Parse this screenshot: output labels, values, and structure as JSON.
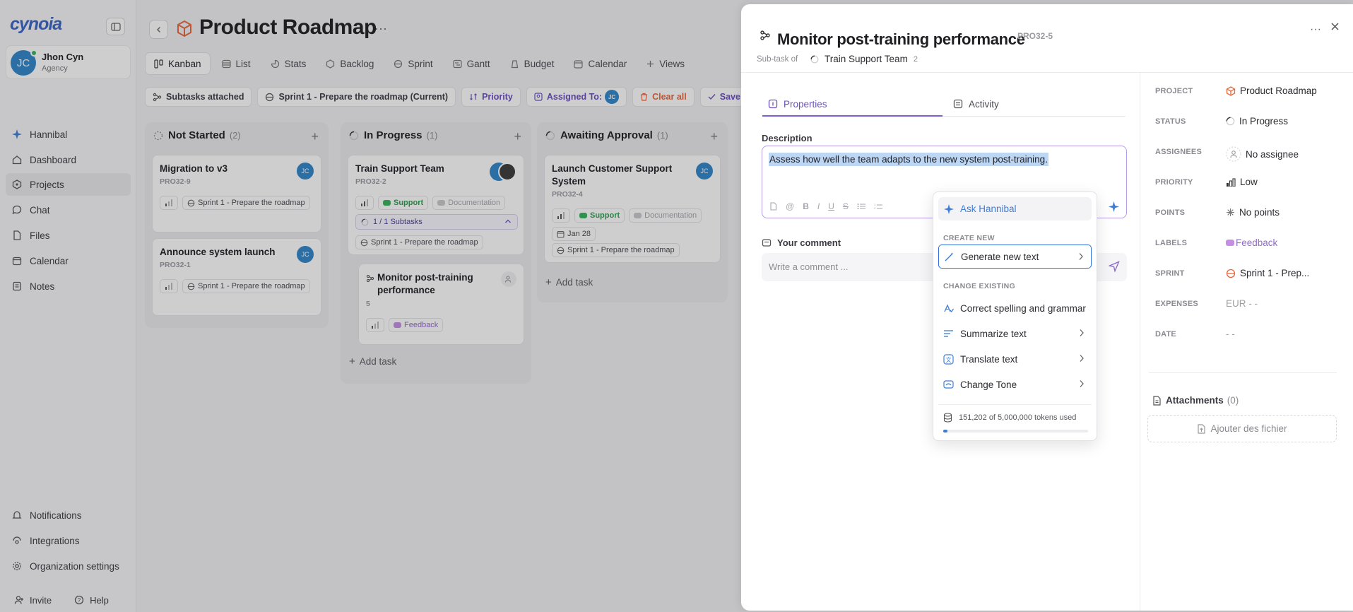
{
  "sidebar": {
    "logo": "cynoia",
    "user": {
      "initials": "JC",
      "name": "Jhon Cyn",
      "role": "Agency"
    },
    "nav": [
      {
        "label": "Hannibal",
        "icon": "sparkle-icon"
      },
      {
        "label": "Dashboard",
        "icon": "home-icon"
      },
      {
        "label": "Projects",
        "icon": "projects-icon",
        "active": true
      },
      {
        "label": "Chat",
        "icon": "chat-icon"
      },
      {
        "label": "Files",
        "icon": "file-icon"
      },
      {
        "label": "Calendar",
        "icon": "calendar-icon"
      },
      {
        "label": "Notes",
        "icon": "notes-icon"
      }
    ],
    "bottom_nav": [
      {
        "label": "Notifications",
        "icon": "bell-icon"
      },
      {
        "label": "Integrations",
        "icon": "integrations-icon"
      },
      {
        "label": "Organization settings",
        "icon": "gear-icon"
      }
    ],
    "invite_label": "Invite",
    "help_label": "Help"
  },
  "header": {
    "title": "Product Roadmap",
    "more": "···",
    "tabs": [
      {
        "label": "Kanban",
        "active": true
      },
      {
        "label": "List"
      },
      {
        "label": "Stats"
      },
      {
        "label": "Backlog"
      },
      {
        "label": "Sprint"
      },
      {
        "label": "Gantt"
      },
      {
        "label": "Budget"
      },
      {
        "label": "Calendar"
      },
      {
        "label": "Views"
      }
    ]
  },
  "filters": {
    "subtasks": "Subtasks attached",
    "sprint": "Sprint 1 - Prepare the roadmap (Current)",
    "priority": "Priority",
    "assigned": "Assigned To:",
    "assigned_initials": "JC",
    "clear": "Clear all",
    "save": "Save"
  },
  "board": {
    "add_task": "Add task",
    "columns": [
      {
        "name": "Not Started",
        "count": "(2)",
        "cards": [
          {
            "title": "Migration to v3",
            "id": "PRO32-9",
            "sprint": "Sprint 1 - Prepare the roadmap",
            "avatar": "JC"
          },
          {
            "title": "Announce system launch",
            "id": "PRO32-1",
            "sprint": "Sprint 1 - Prepare the roadmap",
            "avatar": "JC"
          }
        ]
      },
      {
        "name": "In Progress",
        "count": "(1)",
        "cards": [
          {
            "title": "Train Support Team",
            "id": "PRO32-2",
            "tags": [
              "Support",
              "Documentation"
            ],
            "subtasks": "1 / 1 Subtasks",
            "sprint": "Sprint 1 - Prepare the roadmap"
          }
        ],
        "subcard": {
          "title_line1": "Monitor post-training",
          "title_line2": "performance",
          "id": "5",
          "tag": "Feedback"
        }
      },
      {
        "name": "Awaiting Approval",
        "count": "(1)",
        "cards": [
          {
            "title_line1": "Launch Customer Support",
            "title_line2": "System",
            "id": "PRO32-4",
            "tags": [
              "Support",
              "Documentation"
            ],
            "date": "Jan 28",
            "sprint": "Sprint 1 - Prepare the roadmap",
            "avatar": "JC"
          }
        ]
      }
    ]
  },
  "task_panel": {
    "title": "Monitor post-training performance",
    "id": "PRO32-5",
    "subtask_of_label": "Sub-task of",
    "parent": "Train Support Team",
    "parent_count": "2",
    "tabs": {
      "properties": "Properties",
      "activity": "Activity"
    },
    "description_label": "Description",
    "description": "Assess how well the team adapts to the new system post-training.",
    "comment_label": "Your comment",
    "comment_placeholder": "Write a comment ...",
    "properties": [
      {
        "key": "PROJECT",
        "value": "Product Roadmap"
      },
      {
        "key": "STATUS",
        "value": "In Progress"
      },
      {
        "key": "ASSIGNEES",
        "value": "No assignee"
      },
      {
        "key": "PRIORITY",
        "value": "Low"
      },
      {
        "key": "POINTS",
        "value": "No points"
      },
      {
        "key": "LABELS",
        "value": "Feedback"
      },
      {
        "key": "SPRINT",
        "value": "Sprint 1 - Prep..."
      },
      {
        "key": "EXPENSES",
        "value": "EUR - -"
      },
      {
        "key": "DATE",
        "value": "- -"
      }
    ],
    "attachments_label": "Attachments",
    "attachments_count": "(0)",
    "attach_button": "Ajouter des fichier"
  },
  "ai_menu": {
    "ask": "Ask Hannibal",
    "create_section": "CREATE NEW",
    "generate": "Generate new text",
    "change_section": "CHANGE EXISTING",
    "correct": "Correct spelling and grammar",
    "summarize": "Summarize text",
    "translate": "Translate text",
    "tone": "Change Tone",
    "tokens": "151,202 of 5,000,000 tokens used",
    "tokens_used": 151202,
    "tokens_total": 5000000
  },
  "colors": {
    "accent": "#7e5fd1",
    "brand": "#3a64c6",
    "link": "#3f7ed6",
    "avatar": "#2f86c9",
    "orange": "#e8673c"
  }
}
